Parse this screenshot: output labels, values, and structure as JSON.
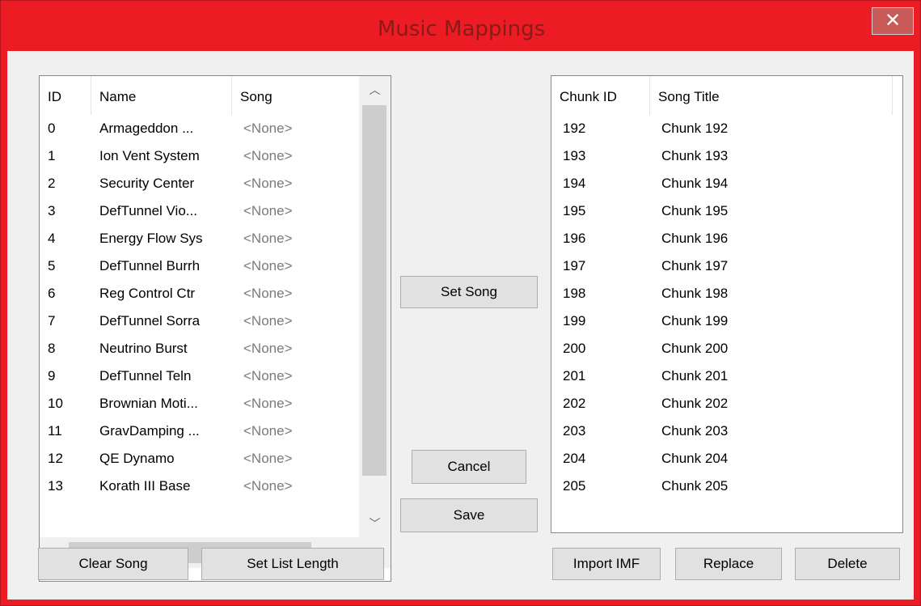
{
  "window": {
    "title": "Music Mappings",
    "close_glyph": "✕"
  },
  "left_list": {
    "columns": [
      "ID",
      "Name",
      "Song"
    ],
    "rows": [
      {
        "id": "0",
        "name": "Armageddon ...",
        "song": "<None>"
      },
      {
        "id": "1",
        "name": "Ion Vent System",
        "song": "<None>"
      },
      {
        "id": "2",
        "name": "Security Center",
        "song": "<None>"
      },
      {
        "id": "3",
        "name": "DefTunnel Vio...",
        "song": "<None>"
      },
      {
        "id": "4",
        "name": "Energy Flow Sys",
        "song": "<None>"
      },
      {
        "id": "5",
        "name": "DefTunnel Burrh",
        "song": "<None>"
      },
      {
        "id": "6",
        "name": "Reg Control Ctr",
        "song": "<None>"
      },
      {
        "id": "7",
        "name": "DefTunnel Sorra",
        "song": "<None>"
      },
      {
        "id": "8",
        "name": "Neutrino Burst",
        "song": "<None>"
      },
      {
        "id": "9",
        "name": "DefTunnel Teln",
        "song": "<None>"
      },
      {
        "id": "10",
        "name": "Brownian Moti...",
        "song": "<None>"
      },
      {
        "id": "11",
        "name": "GravDamping ...",
        "song": "<None>"
      },
      {
        "id": "12",
        "name": "QE Dynamo",
        "song": "<None>"
      },
      {
        "id": "13",
        "name": "Korath III Base",
        "song": "<None>"
      }
    ],
    "scroll_glyphs": {
      "up": "︿",
      "down": "﹀",
      "left": "<",
      "right": ">"
    }
  },
  "right_list": {
    "columns": [
      "Chunk ID",
      "Song Title"
    ],
    "rows": [
      {
        "id": "192",
        "title": "Chunk 192"
      },
      {
        "id": "193",
        "title": "Chunk 193"
      },
      {
        "id": "194",
        "title": "Chunk 194"
      },
      {
        "id": "195",
        "title": "Chunk 195"
      },
      {
        "id": "196",
        "title": "Chunk 196"
      },
      {
        "id": "197",
        "title": "Chunk 197"
      },
      {
        "id": "198",
        "title": "Chunk 198"
      },
      {
        "id": "199",
        "title": "Chunk 199"
      },
      {
        "id": "200",
        "title": "Chunk 200"
      },
      {
        "id": "201",
        "title": "Chunk 201"
      },
      {
        "id": "202",
        "title": "Chunk 202"
      },
      {
        "id": "203",
        "title": "Chunk 203"
      },
      {
        "id": "204",
        "title": "Chunk 204"
      },
      {
        "id": "205",
        "title": "Chunk 205"
      }
    ]
  },
  "buttons": {
    "set_song": "Set Song",
    "cancel": "Cancel",
    "save": "Save",
    "clear_song": "Clear Song",
    "set_list_length": "Set List Length",
    "import_imf": "Import IMF",
    "replace": "Replace",
    "delete": "Delete"
  },
  "colors": {
    "titlebar": "#ed1c24",
    "close_button": "#c85a5a"
  }
}
